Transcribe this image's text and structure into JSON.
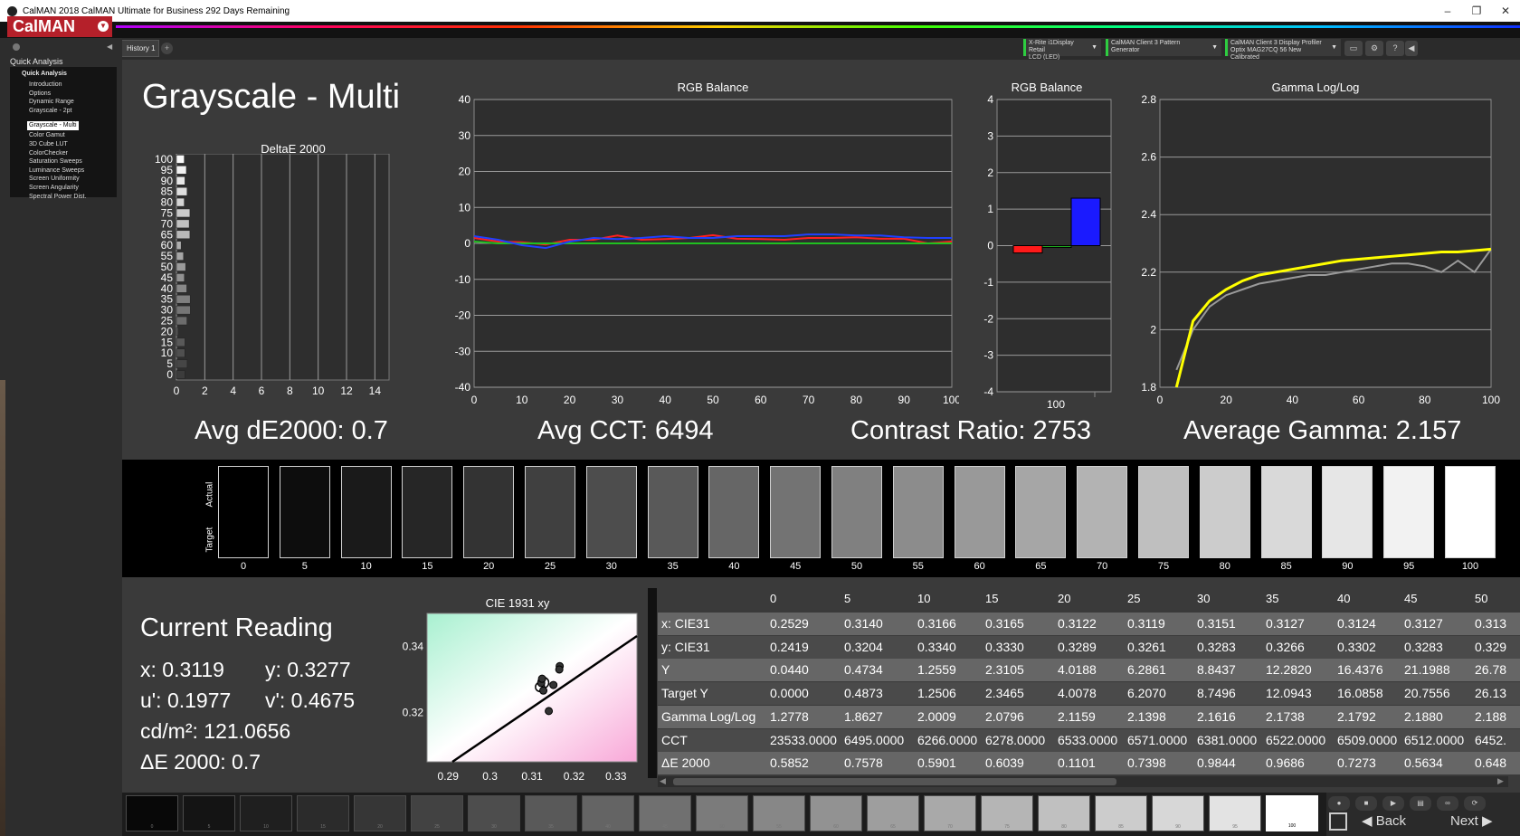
{
  "app": {
    "title": "CalMAN 2018 CalMAN Ultimate for Business 292 Days Remaining",
    "brand": "CalMAN",
    "window_controls": [
      "–",
      "❐",
      "✕"
    ]
  },
  "tabs": [
    {
      "label": "History 1"
    }
  ],
  "devices": [
    {
      "line1": "X-Rite i1Display Retail",
      "line2": "LCD (LED)"
    },
    {
      "line1": "CalMAN Client 3 Pattern Generator",
      "line2": ""
    },
    {
      "line1": "CalMAN Client 3 Display Profiler",
      "line2": "Optix MAG27CQ 56 New Calibrated"
    }
  ],
  "sidebar": {
    "title": "Quick Analysis",
    "group": "Quick Analysis",
    "items": [
      "Introduction",
      "Options",
      "Dynamic Range",
      "Grayscale - 2pt",
      "Grayscale - Multi",
      "Color Gamut",
      "3D Cube LUT",
      "ColorChecker",
      "Saturation Sweeps",
      "Luminance Sweeps",
      "Screen Uniformity",
      "Screen Angularity",
      "Spectral Power Dist."
    ],
    "selected_index": 4
  },
  "page": {
    "title": "Grayscale - Multi"
  },
  "stats": {
    "avg_de": "Avg dE2000: 0.7",
    "avg_cct": "Avg CCT: 6494",
    "contrast": "Contrast Ratio: 2753",
    "avg_gamma": "Average Gamma: 2.157"
  },
  "chart_data": [
    {
      "id": "deltae",
      "type": "bar",
      "title": "DeltaE 2000",
      "orientation": "horizontal",
      "categories": [
        0,
        5,
        10,
        15,
        20,
        25,
        30,
        35,
        40,
        45,
        50,
        55,
        60,
        65,
        70,
        75,
        80,
        85,
        90,
        95,
        100
      ],
      "values": [
        0.59,
        0.76,
        0.59,
        0.6,
        0.11,
        0.74,
        0.98,
        0.97,
        0.73,
        0.56,
        0.65,
        0.5,
        0.33,
        0.95,
        0.9,
        0.95,
        0.55,
        0.75,
        0.6,
        0.7,
        0.55
      ],
      "xlim": [
        0,
        15
      ],
      "xticks": [
        0,
        2,
        4,
        6,
        8,
        10,
        12,
        14
      ],
      "yticks": [
        0,
        5,
        10,
        15,
        20,
        25,
        30,
        35,
        40,
        45,
        50,
        55,
        60,
        65,
        70,
        75,
        80,
        85,
        90,
        95,
        100
      ]
    },
    {
      "id": "rgb_line",
      "type": "line",
      "title": "RGB Balance",
      "x": [
        0,
        5,
        10,
        15,
        20,
        25,
        30,
        35,
        40,
        45,
        50,
        55,
        60,
        65,
        70,
        75,
        80,
        85,
        90,
        95,
        100
      ],
      "series": [
        {
          "color": "#ff2020",
          "values": [
            1.5,
            0.5,
            0.3,
            -0.3,
            1,
            1,
            2.2,
            1,
            1.2,
            1.5,
            2.3,
            1.3,
            1.2,
            1,
            1.5,
            1.5,
            1.7,
            1.3,
            1.3,
            0,
            0.5
          ]
        },
        {
          "color": "#20c020",
          "values": [
            0.5,
            0,
            0,
            0,
            0,
            0,
            0,
            0,
            0,
            0,
            0,
            0,
            0,
            0,
            0,
            0,
            0,
            0,
            0,
            0,
            0
          ]
        },
        {
          "color": "#2040ff",
          "values": [
            2,
            1,
            -0.5,
            -1.3,
            0.5,
            1.5,
            1.2,
            1.5,
            2,
            1.5,
            1.5,
            2,
            2,
            2,
            2.5,
            2.5,
            2.2,
            2.2,
            1.7,
            1.5,
            1.5
          ]
        }
      ],
      "xlim": [
        0,
        100
      ],
      "ylim": [
        -40,
        40
      ],
      "xticks": [
        0,
        10,
        20,
        30,
        40,
        50,
        60,
        70,
        80,
        90,
        100
      ],
      "yticks": [
        40,
        30,
        20,
        10,
        0,
        -10,
        -20,
        -30,
        -40
      ]
    },
    {
      "id": "rgb_bar",
      "type": "bar",
      "title": "RGB Balance",
      "categories": [
        "100"
      ],
      "series": [
        {
          "color": "#ff1a1a",
          "value": -0.2
        },
        {
          "color": "#1faa1f",
          "value": -0.05
        },
        {
          "color": "#1a1aff",
          "value": 1.3
        }
      ],
      "ylim": [
        -4,
        4
      ],
      "yticks": [
        4,
        3,
        2,
        1,
        0,
        -1,
        -2,
        -3,
        -4
      ]
    },
    {
      "id": "gamma",
      "type": "line",
      "title": "Gamma Log/Log",
      "x": [
        5,
        10,
        15,
        20,
        25,
        30,
        35,
        40,
        45,
        50,
        55,
        60,
        65,
        70,
        75,
        80,
        85,
        90,
        95,
        100
      ],
      "series": [
        {
          "color": "#9a9a9a",
          "values": [
            1.86,
            2.0,
            2.08,
            2.12,
            2.14,
            2.16,
            2.17,
            2.18,
            2.19,
            2.19,
            2.2,
            2.21,
            2.22,
            2.23,
            2.23,
            2.22,
            2.2,
            2.24,
            2.2,
            2.28
          ]
        },
        {
          "color": "#ffff00",
          "values": [
            1.8,
            2.03,
            2.1,
            2.14,
            2.17,
            2.19,
            2.2,
            2.21,
            2.22,
            2.23,
            2.24,
            2.245,
            2.25,
            2.255,
            2.26,
            2.265,
            2.27,
            2.27,
            2.275,
            2.28
          ]
        }
      ],
      "xlim": [
        0,
        100
      ],
      "ylim": [
        1.8,
        2.8
      ],
      "xticks": [
        0,
        20,
        40,
        60,
        80,
        100
      ],
      "yticks": [
        2.8,
        2.6,
        2.4,
        2.2,
        2,
        1.8
      ]
    },
    {
      "id": "cie",
      "type": "scatter",
      "title": "CIE 1931 xy",
      "points": [
        {
          "x": 0.3127,
          "y": 0.329,
          "kind": "target"
        },
        {
          "x": 0.3119,
          "y": 0.3277,
          "kind": "current"
        },
        {
          "x": 0.3151,
          "y": 0.3283
        },
        {
          "x": 0.314,
          "y": 0.3204
        },
        {
          "x": 0.3166,
          "y": 0.334
        },
        {
          "x": 0.3165,
          "y": 0.333
        },
        {
          "x": 0.3122,
          "y": 0.3289
        },
        {
          "x": 0.3124,
          "y": 0.3302
        },
        {
          "x": 0.3127,
          "y": 0.3266
        }
      ],
      "xlim": [
        0.285,
        0.335
      ],
      "ylim": [
        0.305,
        0.35
      ],
      "xticks": [
        0.29,
        0.3,
        0.31,
        0.32,
        0.33
      ],
      "yticks": [
        0.34,
        0.32
      ]
    }
  ],
  "swatches": {
    "row_labels": [
      "Actual",
      "Target"
    ],
    "labels": [
      "0",
      "5",
      "10",
      "15",
      "20",
      "25",
      "30",
      "35",
      "40",
      "45",
      "50",
      "55",
      "60",
      "65",
      "70",
      "75",
      "80",
      "85",
      "90",
      "95",
      "100"
    ]
  },
  "current_reading": {
    "title": "Current Reading",
    "x": "x: 0.3119",
    "y": "y: 0.3277",
    "u": "u': 0.1977",
    "v": "v': 0.4675",
    "lum": "cd/m²: 121.0656",
    "de": "ΔE 2000: 0.7"
  },
  "table": {
    "headers": [
      "0",
      "5",
      "10",
      "15",
      "20",
      "25",
      "30",
      "35",
      "40",
      "45",
      "50"
    ],
    "rows": [
      {
        "label": "x: CIE31",
        "values": [
          "0.2529",
          "0.3140",
          "0.3166",
          "0.3165",
          "0.3122",
          "0.3119",
          "0.3151",
          "0.3127",
          "0.3124",
          "0.3127",
          "0.313"
        ]
      },
      {
        "label": "y: CIE31",
        "values": [
          "0.2419",
          "0.3204",
          "0.3340",
          "0.3330",
          "0.3289",
          "0.3261",
          "0.3283",
          "0.3266",
          "0.3302",
          "0.3283",
          "0.329"
        ]
      },
      {
        "label": "Y",
        "values": [
          "0.0440",
          "0.4734",
          "1.2559",
          "2.3105",
          "4.0188",
          "6.2861",
          "8.8437",
          "12.2820",
          "16.4376",
          "21.1988",
          "26.78"
        ]
      },
      {
        "label": "Target Y",
        "values": [
          "0.0000",
          "0.4873",
          "1.2506",
          "2.3465",
          "4.0078",
          "6.2070",
          "8.7496",
          "12.0943",
          "16.0858",
          "20.7556",
          "26.13"
        ]
      },
      {
        "label": "Gamma Log/Log",
        "values": [
          "1.2778",
          "1.8627",
          "2.0009",
          "2.0796",
          "2.1159",
          "2.1398",
          "2.1616",
          "2.1738",
          "2.1792",
          "2.1880",
          "2.188"
        ]
      },
      {
        "label": "CCT",
        "values": [
          "23533.0000",
          "6495.0000",
          "6266.0000",
          "6278.0000",
          "6533.0000",
          "6571.0000",
          "6381.0000",
          "6522.0000",
          "6509.0000",
          "6512.0000",
          "6452."
        ]
      },
      {
        "label": "ΔE 2000",
        "values": [
          "0.5852",
          "0.7578",
          "0.5901",
          "0.6039",
          "0.1101",
          "0.7398",
          "0.9844",
          "0.9686",
          "0.7273",
          "0.5634",
          "0.648"
        ]
      }
    ]
  },
  "filmstrip": {
    "labels": [
      "0",
      "5",
      "10",
      "15",
      "20",
      "25",
      "30",
      "35",
      "40",
      "45",
      "50",
      "55",
      "60",
      "65",
      "70",
      "75",
      "80",
      "85",
      "90",
      "95",
      "100"
    ],
    "selected_index": 20
  },
  "nav": {
    "back": "Back",
    "next": "Next"
  }
}
